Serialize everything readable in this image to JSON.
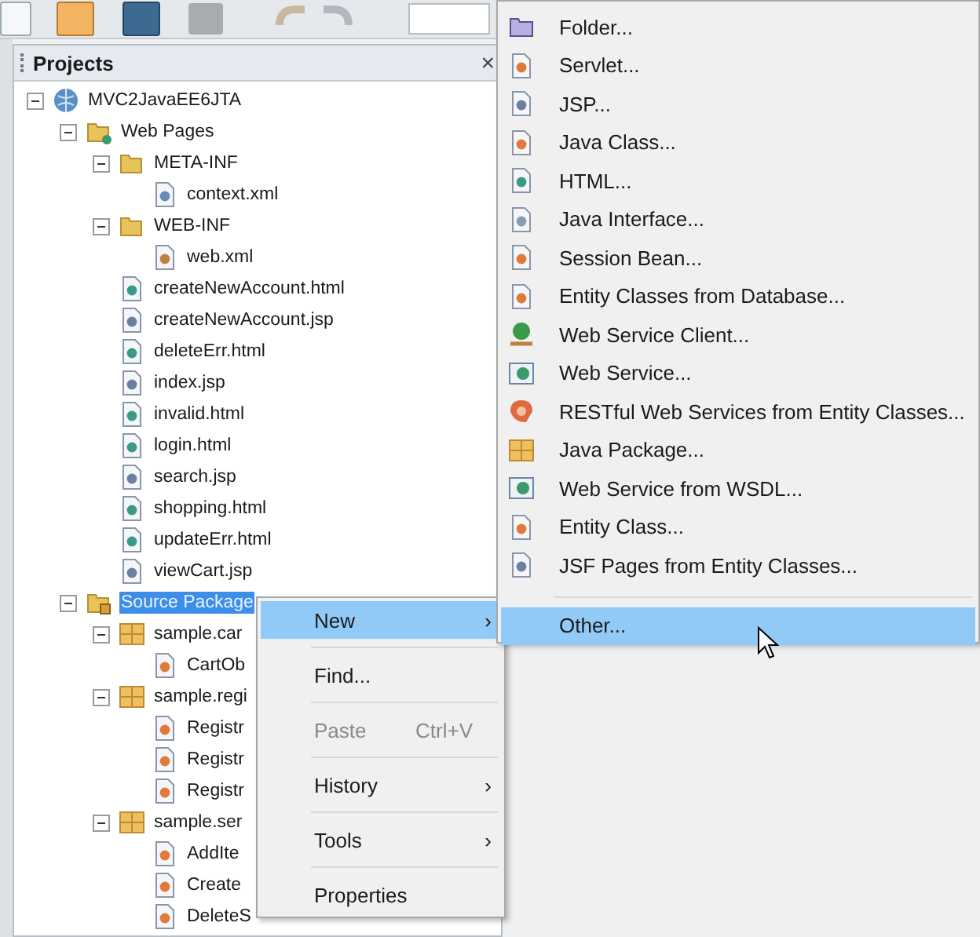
{
  "panel": {
    "title": "Projects",
    "close": "×"
  },
  "tree": [
    {
      "label": "MVC2JavaEE6JTA",
      "kind": "project",
      "expanded": true,
      "selected": false,
      "children": [
        {
          "label": "Web Pages",
          "kind": "webfolder",
          "expanded": true,
          "selected": false,
          "children": [
            {
              "label": "META-INF",
              "kind": "folder",
              "expanded": true,
              "selected": false,
              "children": [
                {
                  "label": "context.xml",
                  "kind": "xml",
                  "selected": false
                }
              ]
            },
            {
              "label": "WEB-INF",
              "kind": "folder",
              "expanded": true,
              "selected": false,
              "children": [
                {
                  "label": "web.xml",
                  "kind": "config",
                  "selected": false
                }
              ]
            },
            {
              "label": "createNewAccount.html",
              "kind": "html",
              "selected": false
            },
            {
              "label": "createNewAccount.jsp",
              "kind": "jsp",
              "selected": false
            },
            {
              "label": "deleteErr.html",
              "kind": "html",
              "selected": false
            },
            {
              "label": "index.jsp",
              "kind": "jsp",
              "selected": false
            },
            {
              "label": "invalid.html",
              "kind": "html",
              "selected": false
            },
            {
              "label": "login.html",
              "kind": "html",
              "selected": false
            },
            {
              "label": "search.jsp",
              "kind": "jsp",
              "selected": false
            },
            {
              "label": "shopping.html",
              "kind": "html",
              "selected": false
            },
            {
              "label": "updateErr.html",
              "kind": "html",
              "selected": false
            },
            {
              "label": "viewCart.jsp",
              "kind": "jsp",
              "selected": false
            }
          ]
        },
        {
          "label": "Source Package",
          "kind": "srcfolder",
          "expanded": true,
          "selected": true,
          "children": [
            {
              "label": "sample.car",
              "kind": "package",
              "expanded": true,
              "selected": false,
              "children": [
                {
                  "label": "CartOb",
                  "kind": "java",
                  "selected": false
                }
              ]
            },
            {
              "label": "sample.regi",
              "kind": "package",
              "expanded": true,
              "selected": false,
              "children": [
                {
                  "label": "Registr",
                  "kind": "java",
                  "selected": false
                },
                {
                  "label": "Registr",
                  "kind": "java",
                  "selected": false
                },
                {
                  "label": "Registr",
                  "kind": "java",
                  "selected": false
                }
              ]
            },
            {
              "label": "sample.ser",
              "kind": "package",
              "expanded": true,
              "selected": false,
              "children": [
                {
                  "label": "AddIte",
                  "kind": "java",
                  "selected": false
                },
                {
                  "label": "Create",
                  "kind": "java",
                  "selected": false
                },
                {
                  "label": "DeleteS",
                  "kind": "java",
                  "selected": false
                }
              ]
            }
          ]
        }
      ]
    }
  ],
  "context_menu": [
    {
      "label": "New",
      "submenu": true,
      "disabled": false,
      "selected": true
    },
    {
      "label": "Find...",
      "submenu": false,
      "disabled": false,
      "selected": false
    },
    {
      "label": "Paste",
      "shortcut": "Ctrl+V",
      "submenu": false,
      "disabled": true,
      "selected": false
    },
    {
      "label": "History",
      "submenu": true,
      "disabled": false,
      "selected": false
    },
    {
      "label": "Tools",
      "submenu": true,
      "disabled": false,
      "selected": false
    },
    {
      "label": "Properties",
      "submenu": false,
      "disabled": false,
      "selected": false
    }
  ],
  "chevron": "›",
  "new_submenu": [
    {
      "kind": "newfolder",
      "label": "Folder...",
      "selected": false
    },
    {
      "kind": "java",
      "label": "Servlet...",
      "selected": false
    },
    {
      "kind": "jsp",
      "label": "JSP...",
      "selected": false
    },
    {
      "kind": "java",
      "label": "Java Class...",
      "selected": false
    },
    {
      "kind": "html",
      "label": "HTML...",
      "selected": false
    },
    {
      "kind": "interface",
      "label": "Java Interface...",
      "selected": false
    },
    {
      "kind": "java",
      "label": "Session Bean...",
      "selected": false
    },
    {
      "kind": "java",
      "label": "Entity Classes from Database...",
      "selected": false
    },
    {
      "kind": "wsclient",
      "label": "Web Service Client...",
      "selected": false
    },
    {
      "kind": "webservice",
      "label": "Web Service...",
      "selected": false
    },
    {
      "kind": "rest",
      "label": "RESTful Web Services from Entity Classes...",
      "selected": false
    },
    {
      "kind": "package",
      "label": "Java Package...",
      "selected": false
    },
    {
      "kind": "webservice",
      "label": "Web Service from WSDL...",
      "selected": false
    },
    {
      "kind": "java",
      "label": "Entity Class...",
      "selected": false
    },
    {
      "kind": "jsp",
      "label": "JSF Pages from Entity Classes...",
      "selected": false
    },
    {
      "kind": "separator"
    },
    {
      "kind": "other",
      "label": "Other...",
      "selected": true
    }
  ]
}
